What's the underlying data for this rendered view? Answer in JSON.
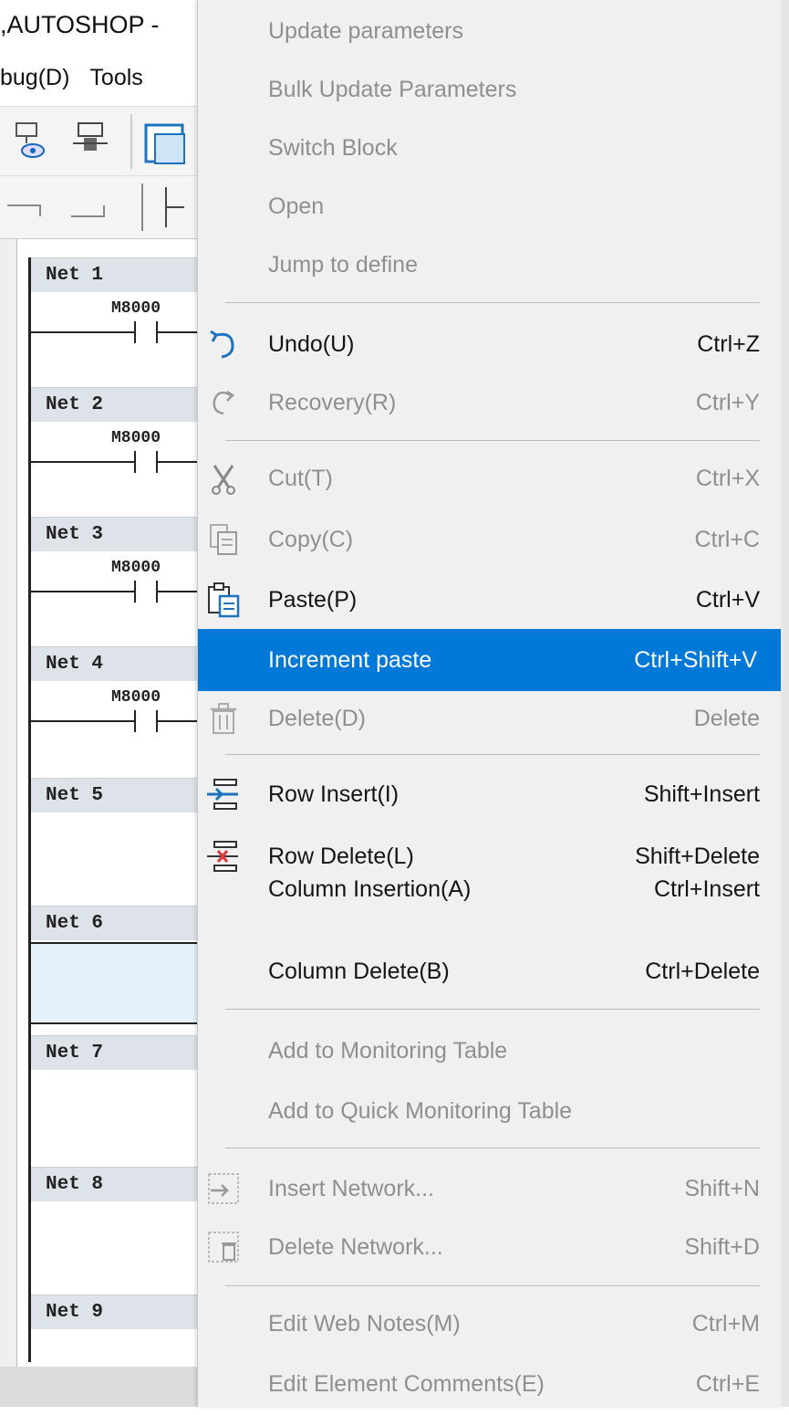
{
  "app": {
    "title": ",AUTOSHOP -",
    "menus": [
      "bug(D)",
      "Tools"
    ],
    "contact_label": "M8000",
    "nets": [
      "Net 1",
      "Net 2",
      "Net 3",
      "Net 4",
      "Net 5",
      "Net 6",
      "Net 7",
      "Net 8",
      "Net 9"
    ]
  },
  "context_menu": {
    "items": [
      {
        "label": "Update parameters",
        "shortcut": "",
        "enabled": false,
        "icon": ""
      },
      {
        "label": "Bulk Update Parameters",
        "shortcut": "",
        "enabled": false,
        "icon": ""
      },
      {
        "label": "Switch Block",
        "shortcut": "",
        "enabled": false,
        "icon": ""
      },
      {
        "label": "Open",
        "shortcut": "",
        "enabled": false,
        "icon": ""
      },
      {
        "label": "Jump to define",
        "shortcut": "",
        "enabled": false,
        "icon": ""
      },
      {
        "label": "Undo(U)",
        "shortcut": "Ctrl+Z",
        "enabled": true,
        "icon": "undo-icon"
      },
      {
        "label": "Recovery(R)",
        "shortcut": "Ctrl+Y",
        "enabled": false,
        "icon": "redo-icon"
      },
      {
        "label": "Cut(T)",
        "shortcut": "Ctrl+X",
        "enabled": false,
        "icon": "cut-icon"
      },
      {
        "label": "Copy(C)",
        "shortcut": "Ctrl+C",
        "enabled": false,
        "icon": "copy-icon"
      },
      {
        "label": "Paste(P)",
        "shortcut": "Ctrl+V",
        "enabled": true,
        "icon": "paste-icon"
      },
      {
        "label": "Increment paste",
        "shortcut": "Ctrl+Shift+V",
        "enabled": true,
        "highlighted": true,
        "icon": ""
      },
      {
        "label": "Delete(D)",
        "shortcut": "Delete",
        "enabled": false,
        "icon": "trash-icon"
      },
      {
        "label": "Row Insert(I)",
        "shortcut": "Shift+Insert",
        "enabled": true,
        "icon": "row-insert-icon"
      },
      {
        "label": "Row Delete(L)",
        "shortcut": "Shift+Delete",
        "enabled": true,
        "icon": "row-delete-icon"
      },
      {
        "label": "Column Insertion(A)",
        "shortcut": "Ctrl+Insert",
        "enabled": true,
        "icon": ""
      },
      {
        "label": "Column Delete(B)",
        "shortcut": "Ctrl+Delete",
        "enabled": true,
        "icon": ""
      },
      {
        "label": "Add to Monitoring Table",
        "shortcut": "",
        "enabled": false,
        "icon": ""
      },
      {
        "label": "Add to Quick Monitoring Table",
        "shortcut": "",
        "enabled": false,
        "icon": ""
      },
      {
        "label": "Insert Network...",
        "shortcut": "Shift+N",
        "enabled": false,
        "icon": "insert-network-icon"
      },
      {
        "label": "Delete Network...",
        "shortcut": "Shift+D",
        "enabled": false,
        "icon": "delete-network-icon"
      },
      {
        "label": "Edit Web Notes(M)",
        "shortcut": "Ctrl+M",
        "enabled": false,
        "icon": ""
      },
      {
        "label": "Edit Element Comments(E)",
        "shortcut": "Ctrl+E",
        "enabled": false,
        "icon": ""
      }
    ]
  },
  "colors": {
    "highlight": "#0078d7",
    "menu_bg": "#f0f0f0",
    "disabled_text": "#8f8f8f"
  }
}
